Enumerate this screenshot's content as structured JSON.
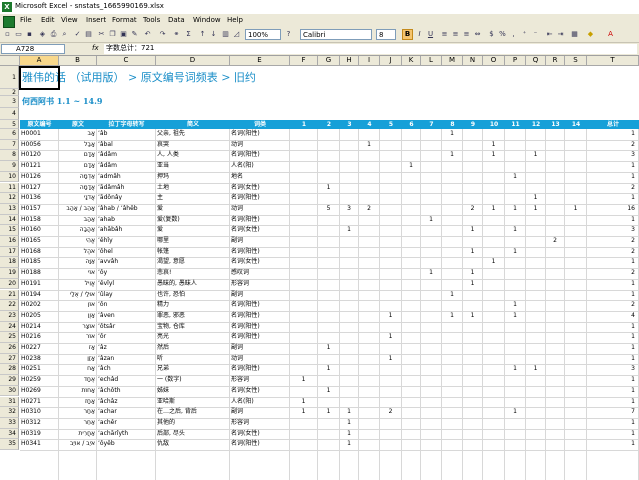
{
  "window": {
    "title": "Microsoft Excel - snstats_1665990169.xlsx"
  },
  "menu": [
    "File",
    "Edit",
    "View",
    "Insert",
    "Format",
    "Tools",
    "Data",
    "Window",
    "Help"
  ],
  "toolbar": {
    "zoom": "100%",
    "font": "Calibri",
    "size": "8",
    "bold": "B"
  },
  "formula_bar": {
    "name_box": "A728",
    "fx": "fx",
    "formula": "字数总计：721"
  },
  "columns": [
    "A",
    "B",
    "C",
    "D",
    "E",
    "F",
    "G",
    "H",
    "I",
    "J",
    "K",
    "L",
    "M",
    "N",
    "O",
    "P",
    "Q",
    "R",
    "S",
    "T"
  ],
  "title_row": "雅伟的话 （试用版） > 原文编号词频表 > 旧约",
  "subtitle_row": "何西阿书 1.1 ~ 14.9",
  "table_headers": [
    "原文编号",
    "原文",
    "拉丁字母转写",
    "简义",
    "词类",
    "1",
    "2",
    "3",
    "4",
    "5",
    "6",
    "7",
    "8",
    "9",
    "10",
    "11",
    "12",
    "13",
    "14",
    "总计"
  ],
  "rows": [
    {
      "n": "6",
      "id": "H0001",
      "orig": "אָב",
      "lat": "ʼâb",
      "mean": "父亲, 祖先",
      "pos": "名词(阳性)",
      "c": [
        "",
        "",
        "",
        "",
        "",
        "",
        "",
        "1",
        "",
        "",
        "",
        "",
        "",
        ""
      ],
      "t": "1"
    },
    {
      "n": "7",
      "id": "H0056",
      "orig": "אָבַל",
      "lat": "ʼâbal",
      "mean": "哀哭",
      "pos": "动词",
      "c": [
        "",
        "",
        "",
        "1",
        "",
        "",
        "",
        "",
        "",
        "1",
        "",
        "",
        "",
        ""
      ],
      "t": "2"
    },
    {
      "n": "8",
      "id": "H0120",
      "orig": "אָדָם",
      "lat": "ʼâdâm",
      "mean": "人, 人类",
      "pos": "名词(阳性)",
      "c": [
        "",
        "",
        "",
        "",
        "",
        "",
        "",
        "1",
        "",
        "1",
        "",
        "1",
        "",
        ""
      ],
      "t": "3"
    },
    {
      "n": "9",
      "id": "H0121",
      "orig": "אָדָם",
      "lat": "ʼâdâm",
      "mean": "亚当",
      "pos": "人名(阳)",
      "c": [
        "",
        "",
        "",
        "",
        "",
        "1",
        "",
        "",
        "",
        "",
        "",
        "",
        "",
        ""
      ],
      "t": "1"
    },
    {
      "n": "10",
      "id": "H0126",
      "orig": "אַדְמָה",
      "lat": "ʼadmâh",
      "mean": "押玛",
      "pos": "地名",
      "c": [
        "",
        "",
        "",
        "",
        "",
        "",
        "",
        "",
        "",
        "",
        "1",
        "",
        "",
        ""
      ],
      "t": "1"
    },
    {
      "n": "11",
      "id": "H0127",
      "orig": "אֲדָמָה",
      "lat": "ʼădâmâh",
      "mean": "土地",
      "pos": "名词(女性)",
      "c": [
        "",
        "1",
        "",
        "",
        "",
        "",
        "",
        "",
        "",
        "",
        "",
        "",
        "",
        ""
      ],
      "t": "2"
    },
    {
      "n": "12",
      "id": "H0136",
      "orig": "אֲדֹנָי",
      "lat": "ʼădônây",
      "mean": "主",
      "pos": "名词(阳性)",
      "c": [
        "",
        "",
        "",
        "",
        "",
        "",
        "",
        "",
        "",
        "",
        "",
        "1",
        "",
        ""
      ],
      "t": "1"
    },
    {
      "n": "13",
      "id": "H0157",
      "orig": "אָהֵב / אָהַב",
      "lat": "ʼâhab / ʼâhêb",
      "mean": "爱",
      "pos": "动词",
      "c": [
        "",
        "5",
        "3",
        "2",
        "",
        "",
        "",
        "",
        "2",
        "1",
        "1",
        "1",
        "",
        "1"
      ],
      "t": "16"
    },
    {
      "n": "14",
      "id": "H0158",
      "orig": "אַהַב",
      "lat": "ʼahab",
      "mean": "爱(复数)",
      "pos": "名词(阳性)",
      "c": [
        "",
        "",
        "",
        "",
        "",
        "",
        "1",
        "",
        "",
        "",
        "",
        "",
        "",
        ""
      ],
      "t": "1"
    },
    {
      "n": "15",
      "id": "H0160",
      "orig": "אַהֲבָה",
      "lat": "ʼahăbâh",
      "mean": "爱",
      "pos": "名词(女性)",
      "c": [
        "",
        "",
        "1",
        "",
        "",
        "",
        "",
        "",
        "1",
        "",
        "1",
        "",
        "",
        ""
      ],
      "t": "3"
    },
    {
      "n": "16",
      "id": "H0165",
      "orig": "אֱהִי",
      "lat": "ʼěhîy",
      "mean": "哪里",
      "pos": "副词",
      "c": [
        "",
        "",
        "",
        "",
        "",
        "",
        "",
        "",
        "",
        "",
        "",
        "",
        "2",
        ""
      ],
      "t": "2"
    },
    {
      "n": "17",
      "id": "H0168",
      "orig": "אֹהֶל",
      "lat": "ʼôhel",
      "mean": "帐篷",
      "pos": "名词(阳性)",
      "c": [
        "",
        "",
        "",
        "",
        "",
        "",
        "",
        "",
        "1",
        "",
        "1",
        "",
        "",
        ""
      ],
      "t": "2"
    },
    {
      "n": "18",
      "id": "H0185",
      "orig": "אַוָּה",
      "lat": "ʼavvâh",
      "mean": "渴望, 意愿",
      "pos": "名词(女性)",
      "c": [
        "",
        "",
        "",
        "",
        "",
        "",
        "",
        "",
        "",
        "1",
        "",
        "",
        "",
        ""
      ],
      "t": "1"
    },
    {
      "n": "19",
      "id": "H0188",
      "orig": "אוֹי",
      "lat": "ʼôy",
      "mean": "悲哀!",
      "pos": "感叹词",
      "c": [
        "",
        "",
        "",
        "",
        "",
        "",
        "1",
        "",
        "1",
        "",
        "",
        "",
        "",
        ""
      ],
      "t": "2"
    },
    {
      "n": "20",
      "id": "H0191",
      "orig": "אֱוִיל",
      "lat": "ʼěvîyl",
      "mean": "愚昧的, 愚昧人",
      "pos": "形容词",
      "c": [
        "",
        "",
        "",
        "",
        "",
        "",
        "",
        "",
        "1",
        "",
        "",
        "",
        "",
        ""
      ],
      "t": "1"
    },
    {
      "n": "21",
      "id": "H0194",
      "orig": "אוּלַי / אֻלַי",
      "lat": "ʼûlay",
      "mean": "也许, 恐怕",
      "pos": "副词",
      "c": [
        "",
        "",
        "",
        "",
        "",
        "",
        "",
        "1",
        "",
        "",
        "",
        "",
        "",
        ""
      ],
      "t": "1"
    },
    {
      "n": "22",
      "id": "H0202",
      "orig": "אוֹן",
      "lat": "ʼôn",
      "mean": "精力",
      "pos": "名词(阳性)",
      "c": [
        "",
        "",
        "",
        "",
        "",
        "",
        "",
        "",
        "",
        "",
        "1",
        "",
        "",
        ""
      ],
      "t": "2"
    },
    {
      "n": "23",
      "id": "H0205",
      "orig": "אָוֶן",
      "lat": "ʼâven",
      "mean": "罪恶, 邪恶",
      "pos": "名词(阳性)",
      "c": [
        "",
        "",
        "",
        "",
        "1",
        "",
        "",
        "1",
        "1",
        "",
        "1",
        "",
        "",
        ""
      ],
      "t": "4"
    },
    {
      "n": "24",
      "id": "H0214",
      "orig": "אוֹצָר",
      "lat": "ʼôtsâr",
      "mean": "宝物, 仓库",
      "pos": "名词(阳性)",
      "c": [
        "",
        "",
        "",
        "",
        "",
        "",
        "",
        "",
        "",
        "",
        "",
        "",
        "",
        ""
      ],
      "t": "1"
    },
    {
      "n": "25",
      "id": "H0216",
      "orig": "אוֹר",
      "lat": "ʼôr",
      "mean": "亮光",
      "pos": "名词(阳性)",
      "c": [
        "",
        "",
        "",
        "",
        "1",
        "",
        "",
        "",
        "",
        "",
        "",
        "",
        "",
        ""
      ],
      "t": "1"
    },
    {
      "n": "26",
      "id": "H0227",
      "orig": "אָז",
      "lat": "ʼâz",
      "mean": "然后",
      "pos": "副词",
      "c": [
        "",
        "1",
        "",
        "",
        "",
        "",
        "",
        "",
        "",
        "",
        "",
        "",
        "",
        ""
      ],
      "t": "1"
    },
    {
      "n": "27",
      "id": "H0238",
      "orig": "אָזַן",
      "lat": "ʼâzan",
      "mean": "听",
      "pos": "动词",
      "c": [
        "",
        "",
        "",
        "",
        "1",
        "",
        "",
        "",
        "",
        "",
        "",
        "",
        "",
        ""
      ],
      "t": "1"
    },
    {
      "n": "28",
      "id": "H0251",
      "orig": "אָח",
      "lat": "ʼâch",
      "mean": "兄弟",
      "pos": "名词(阳性)",
      "c": [
        "",
        "1",
        "",
        "",
        "",
        "",
        "",
        "",
        "",
        "",
        "1",
        "1",
        "",
        ""
      ],
      "t": "3"
    },
    {
      "n": "29",
      "id": "H0259",
      "orig": "אֶחָד",
      "lat": "ʼechâd",
      "mean": "一 (数字)",
      "pos": "形容词",
      "c": [
        "1",
        "",
        "",
        "",
        "",
        "",
        "",
        "",
        "",
        "",
        "",
        "",
        "",
        ""
      ],
      "t": "1"
    },
    {
      "n": "30",
      "id": "H0269",
      "orig": "אָחוֹת",
      "lat": "ʼâchôth",
      "mean": "姊妹",
      "pos": "名词(女性)",
      "c": [
        "",
        "1",
        "",
        "",
        "",
        "",
        "",
        "",
        "",
        "",
        "",
        "",
        "",
        ""
      ],
      "t": "1"
    },
    {
      "n": "31",
      "id": "H0271",
      "orig": "אָחָז",
      "lat": "ʼâchâz",
      "mean": "亚哈斯",
      "pos": "人名(阳)",
      "c": [
        "1",
        "",
        "",
        "",
        "",
        "",
        "",
        "",
        "",
        "",
        "",
        "",
        "",
        ""
      ],
      "t": "1"
    },
    {
      "n": "32",
      "id": "H0310",
      "orig": "אַחַר",
      "lat": "ʼachar",
      "mean": "在…之后, 背后",
      "pos": "副词",
      "c": [
        "1",
        "1",
        "1",
        "",
        "2",
        "",
        "",
        "",
        "",
        "",
        "1",
        "",
        "",
        ""
      ],
      "t": "7"
    },
    {
      "n": "33",
      "id": "H0312",
      "orig": "אַחֵר",
      "lat": "ʼachêr",
      "mean": "其他的",
      "pos": "形容词",
      "c": [
        "",
        "",
        "1",
        "",
        "",
        "",
        "",
        "",
        "",
        "",
        "",
        "",
        "",
        ""
      ],
      "t": "1"
    },
    {
      "n": "34",
      "id": "H0319",
      "orig": "אַחֲרִית",
      "lat": "ʼachărîyth",
      "mean": "后部, 尽头",
      "pos": "名词(女性)",
      "c": [
        "",
        "",
        "1",
        "",
        "",
        "",
        "",
        "",
        "",
        "",
        "",
        "",
        "",
        ""
      ],
      "t": "1"
    },
    {
      "n": "35",
      "id": "H0341",
      "orig": "אֹיֵב / אוֹיֵב",
      "lat": "ʼôyêb",
      "mean": "仇敌",
      "pos": "名词(阳性)",
      "c": [
        "",
        "",
        "1",
        "",
        "",
        "",
        "",
        "",
        "",
        "",
        "",
        "",
        "",
        ""
      ],
      "t": "1"
    }
  ]
}
